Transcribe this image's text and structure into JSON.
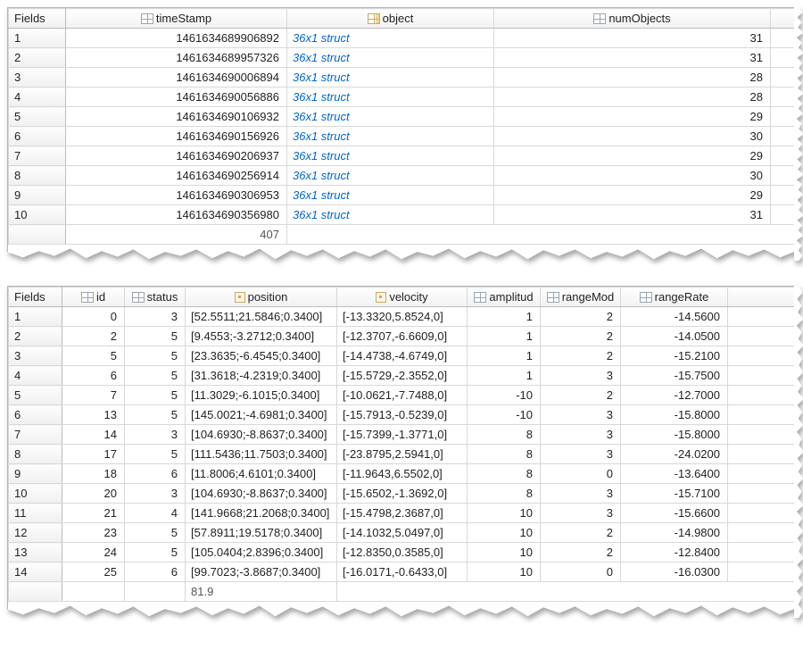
{
  "top": {
    "fields_label": "Fields",
    "headers": {
      "timeStamp": "timeStamp",
      "object": "object",
      "numObjects": "numObjects"
    },
    "rows": [
      {
        "idx": "1",
        "timeStamp": "1461634689906892",
        "object": "36x1 struct",
        "numObjects": "31"
      },
      {
        "idx": "2",
        "timeStamp": "1461634689957326",
        "object": "36x1 struct",
        "numObjects": "31"
      },
      {
        "idx": "3",
        "timeStamp": "1461634690006894",
        "object": "36x1 struct",
        "numObjects": "28"
      },
      {
        "idx": "4",
        "timeStamp": "1461634690056886",
        "object": "36x1 struct",
        "numObjects": "28"
      },
      {
        "idx": "5",
        "timeStamp": "1461634690106932",
        "object": "36x1 struct",
        "numObjects": "29"
      },
      {
        "idx": "6",
        "timeStamp": "1461634690156926",
        "object": "36x1 struct",
        "numObjects": "30"
      },
      {
        "idx": "7",
        "timeStamp": "1461634690206937",
        "object": "36x1 struct",
        "numObjects": "29"
      },
      {
        "idx": "8",
        "timeStamp": "1461634690256914",
        "object": "36x1 struct",
        "numObjects": "30"
      },
      {
        "idx": "9",
        "timeStamp": "1461634690306953",
        "object": "36x1 struct",
        "numObjects": "29"
      },
      {
        "idx": "10",
        "timeStamp": "1461634690356980",
        "object": "36x1 struct",
        "numObjects": "31"
      }
    ],
    "partial": "407"
  },
  "bottom": {
    "fields_label": "Fields",
    "headers": {
      "id": "id",
      "status": "status",
      "position": "position",
      "velocity": "velocity",
      "amplitude": "amplitud",
      "rangeMode": "rangeMod",
      "rangeRate": "rangeRate"
    },
    "rows": [
      {
        "idx": "1",
        "id": "0",
        "status": "3",
        "position": "[52.5511;21.5846;0.3400]",
        "velocity": "[-13.3320,5.8524,0]",
        "amplitude": "1",
        "rangeMode": "2",
        "rangeRate": "-14.5600"
      },
      {
        "idx": "2",
        "id": "2",
        "status": "5",
        "position": "[9.4553;-3.2712;0.3400]",
        "velocity": "[-12.3707,-6.6609,0]",
        "amplitude": "1",
        "rangeMode": "2",
        "rangeRate": "-14.0500"
      },
      {
        "idx": "3",
        "id": "5",
        "status": "5",
        "position": "[23.3635;-6.4545;0.3400]",
        "velocity": "[-14.4738,-4.6749,0]",
        "amplitude": "1",
        "rangeMode": "2",
        "rangeRate": "-15.2100"
      },
      {
        "idx": "4",
        "id": "6",
        "status": "5",
        "position": "[31.3618;-4.2319;0.3400]",
        "velocity": "[-15.5729,-2.3552,0]",
        "amplitude": "1",
        "rangeMode": "3",
        "rangeRate": "-15.7500"
      },
      {
        "idx": "5",
        "id": "7",
        "status": "5",
        "position": "[11.3029;-6.1015;0.3400]",
        "velocity": "[-10.0621,-7.7488,0]",
        "amplitude": "-10",
        "rangeMode": "2",
        "rangeRate": "-12.7000"
      },
      {
        "idx": "6",
        "id": "13",
        "status": "5",
        "position": "[145.0021;-4.6981;0.3400]",
        "velocity": "[-15.7913,-0.5239,0]",
        "amplitude": "-10",
        "rangeMode": "3",
        "rangeRate": "-15.8000"
      },
      {
        "idx": "7",
        "id": "14",
        "status": "3",
        "position": "[104.6930;-8.8637;0.3400]",
        "velocity": "[-15.7399,-1.3771,0]",
        "amplitude": "8",
        "rangeMode": "3",
        "rangeRate": "-15.8000"
      },
      {
        "idx": "8",
        "id": "17",
        "status": "5",
        "position": "[111.5436;11.7503;0.3400]",
        "velocity": "[-23.8795,2.5941,0]",
        "amplitude": "8",
        "rangeMode": "3",
        "rangeRate": "-24.0200"
      },
      {
        "idx": "9",
        "id": "18",
        "status": "6",
        "position": "[11.8006;4.6101;0.3400]",
        "velocity": "[-11.9643,6.5502,0]",
        "amplitude": "8",
        "rangeMode": "0",
        "rangeRate": "-13.6400"
      },
      {
        "idx": "10",
        "id": "20",
        "status": "3",
        "position": "[104.6930;-8.8637;0.3400]",
        "velocity": "[-15.6502,-1.3692,0]",
        "amplitude": "8",
        "rangeMode": "3",
        "rangeRate": "-15.7100"
      },
      {
        "idx": "11",
        "id": "21",
        "status": "4",
        "position": "[141.9668;21.2068;0.3400]",
        "velocity": "[-15.4798,2.3687,0]",
        "amplitude": "10",
        "rangeMode": "3",
        "rangeRate": "-15.6600"
      },
      {
        "idx": "12",
        "id": "23",
        "status": "5",
        "position": "[57.8911;19.5178;0.3400]",
        "velocity": "[-14.1032,5.0497,0]",
        "amplitude": "10",
        "rangeMode": "2",
        "rangeRate": "-14.9800"
      },
      {
        "idx": "13",
        "id": "24",
        "status": "5",
        "position": "[105.0404;2.8396;0.3400]",
        "velocity": "[-12.8350,0.3585,0]",
        "amplitude": "10",
        "rangeMode": "2",
        "rangeRate": "-12.8400"
      },
      {
        "idx": "14",
        "id": "25",
        "status": "6",
        "position": "[99.7023;-3.8687;0.3400]",
        "velocity": "[-16.0171,-0.6433,0]",
        "amplitude": "10",
        "rangeMode": "0",
        "rangeRate": "-16.0300"
      }
    ],
    "partial": "81.9"
  }
}
